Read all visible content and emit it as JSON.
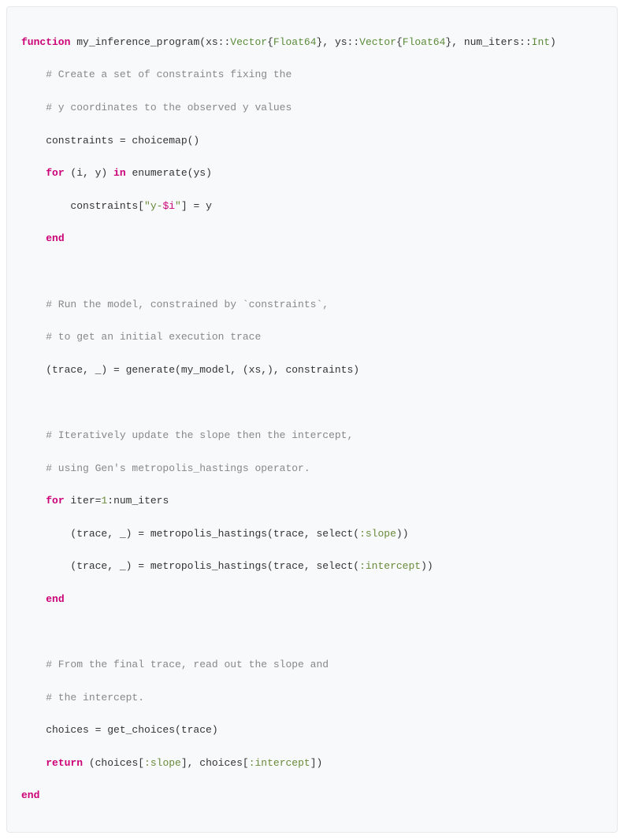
{
  "code": {
    "lines": {
      "l1": {
        "kw": "function",
        "name": " my_inference_program",
        "p1": "(",
        "arg1": "xs",
        "sep1": "::",
        "t1": "Vector",
        "br1": "{",
        "t1a": "Float64",
        "br2": "}",
        "c1": ", ",
        "arg2": "ys",
        "sep2": "::",
        "t2": "Vector",
        "br3": "{",
        "t2a": "Float64",
        "br4": "}",
        "c2": ", ",
        "arg3": "num_iters",
        "sep3": "::",
        "t3": "Int",
        "p2": ")"
      },
      "l2": "    # Create a set of constraints fixing the",
      "l3": "    # y coordinates to the observed y values",
      "l4": "    constraints = choicemap()",
      "l5": {
        "pre": "    ",
        "kw1": "for",
        "mid": " (i, y) ",
        "kw2": "in",
        "tail": " enumerate(ys)"
      },
      "l6": {
        "pre": "        constraints[",
        "s1": "\"y-",
        "interp": "$i",
        "s2": "\"",
        "tail": "] = y"
      },
      "l7": {
        "pre": "    ",
        "kw": "end"
      },
      "l8": "",
      "l9": "    # Run the model, constrained by `constraints`,",
      "l10": "    # to get an initial execution trace",
      "l11": "    (trace, _) = generate(my_model, (xs,), constraints)",
      "l12": "",
      "l13": "    # Iteratively update the slope then the intercept,",
      "l14": "    # using Gen's metropolis_hastings operator.",
      "l15": {
        "pre": "    ",
        "kw": "for",
        "mid": " iter=",
        "n1": "1",
        "sep": ":",
        "tail": "num_iters"
      },
      "l16": {
        "pre": "        (trace, _) = metropolis_hastings(trace, select(",
        "sym": ":slope",
        "tail": "))"
      },
      "l17": {
        "pre": "        (trace, _) = metropolis_hastings(trace, select(",
        "sym": ":intercept",
        "tail": "))"
      },
      "l18": {
        "pre": "    ",
        "kw": "end"
      },
      "l19": "",
      "l20": "    # From the final trace, read out the slope and",
      "l21": "    # the intercept.",
      "l22": "    choices = get_choices(trace)",
      "l23": {
        "pre": "    ",
        "kw": "return",
        "mid": " (choices[",
        "sym1": ":slope",
        "c1": "], choices[",
        "sym2": ":intercept",
        "tail": "])"
      },
      "l24": {
        "kw": "end"
      }
    }
  }
}
